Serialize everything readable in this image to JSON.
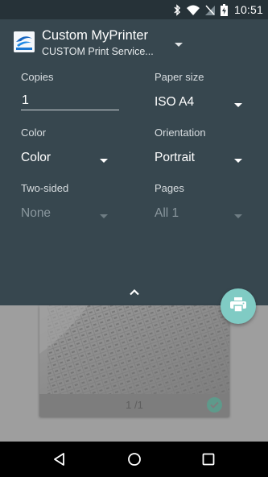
{
  "status_bar": {
    "time": "10:51",
    "icons": [
      "bluetooth-icon",
      "wifi-icon",
      "no-sim-icon",
      "battery-charging-icon"
    ]
  },
  "printer": {
    "name": "Custom MyPrinter",
    "service": "CUSTOM Print Service...",
    "logo_text": "Print",
    "icon": "chevron-down-icon"
  },
  "options": {
    "copies": {
      "label": "Copies",
      "value": "1"
    },
    "paper_size": {
      "label": "Paper size",
      "value": "ISO A4"
    },
    "color": {
      "label": "Color",
      "value": "Color"
    },
    "orientation": {
      "label": "Orientation",
      "value": "Portrait"
    },
    "two_sided": {
      "label": "Two-sided",
      "value": "None",
      "enabled": false
    },
    "pages": {
      "label": "Pages",
      "value": "All 1",
      "enabled": false
    }
  },
  "preview": {
    "page_counter": "1 /1",
    "selected": true
  },
  "colors": {
    "status_bar": "#263238",
    "panel": "#37474f",
    "fab": "#80cbc4",
    "check": "#5e9a8b",
    "preview_background": "#9e9e9e"
  },
  "nav_bar": {
    "icons": [
      "back-icon",
      "home-icon",
      "recents-icon"
    ]
  }
}
